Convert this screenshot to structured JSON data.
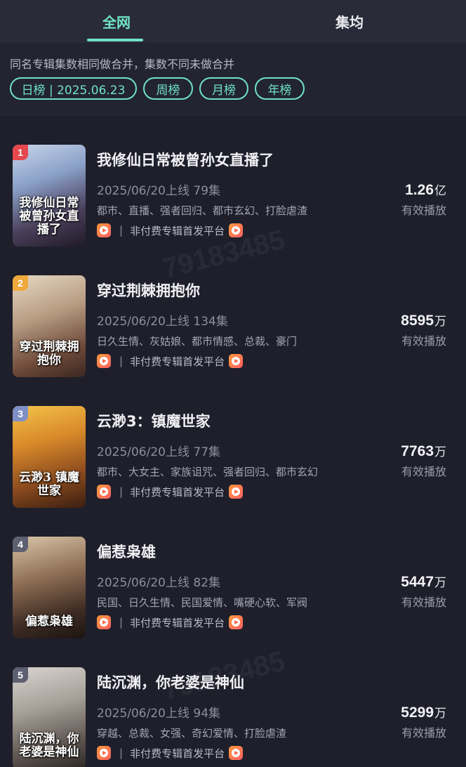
{
  "tabs": [
    {
      "label": "全网",
      "active": true
    },
    {
      "label": "集均",
      "active": false
    }
  ],
  "notice": "同名专辑集数相同做合并，集数不同未做合并",
  "filters": [
    "日榜 | 2025.06.23",
    "周榜",
    "月榜",
    "年榜"
  ],
  "colors": {
    "accent": "#6fe3c4",
    "background": "#1e1f2b",
    "rank1": "#e5484d",
    "rank2": "#f0a83c",
    "rank3": "#7f90c6",
    "rank_other": "#5d6070"
  },
  "watermark": "79183485",
  "items": [
    {
      "rank": "1",
      "poster_text": "我修仙日常被曾孙女直播了",
      "title": "我修仙日常被曾孙女直播了",
      "meta": "2025/06/20上线 79集",
      "tags": "都市、直播、强者回归、都市玄幻、打脸虐渣",
      "platform": "非付费专辑首发平台",
      "views_number": "1.26",
      "views_unit": "亿",
      "views_label": "有效播放"
    },
    {
      "rank": "2",
      "poster_text": "穿过荆棘拥抱你",
      "title": "穿过荆棘拥抱你",
      "meta": "2025/06/20上线 134集",
      "tags": "日久生情、灰姑娘、都市情感、总裁、豪门",
      "platform": "非付费专辑首发平台",
      "views_number": "8595",
      "views_unit": "万",
      "views_label": "有效播放"
    },
    {
      "rank": "3",
      "poster_text": "云渺3 镇魔世家",
      "title": "云渺3：镇魔世家",
      "meta": "2025/06/20上线 77集",
      "tags": "都市、大女主、家族诅咒、强者回归、都市玄幻",
      "platform": "非付费专辑首发平台",
      "views_number": "7763",
      "views_unit": "万",
      "views_label": "有效播放"
    },
    {
      "rank": "4",
      "poster_text": "偏惹枭雄",
      "title": "偏惹枭雄",
      "meta": "2025/06/20上线 82集",
      "tags": "民国、日久生情、民国爱情、嘴硬心软、军阀",
      "platform": "非付费专辑首发平台",
      "views_number": "5447",
      "views_unit": "万",
      "views_label": "有效播放"
    },
    {
      "rank": "5",
      "poster_text": "陆沉渊，你老婆是神仙",
      "title": "陆沉渊，你老婆是神仙",
      "meta": "2025/06/20上线 94集",
      "tags": "穿越、总裁、女强、奇幻爱情、打脸虐渣",
      "platform": "非付费专辑首发平台",
      "views_number": "5299",
      "views_unit": "万",
      "views_label": "有效播放"
    }
  ]
}
